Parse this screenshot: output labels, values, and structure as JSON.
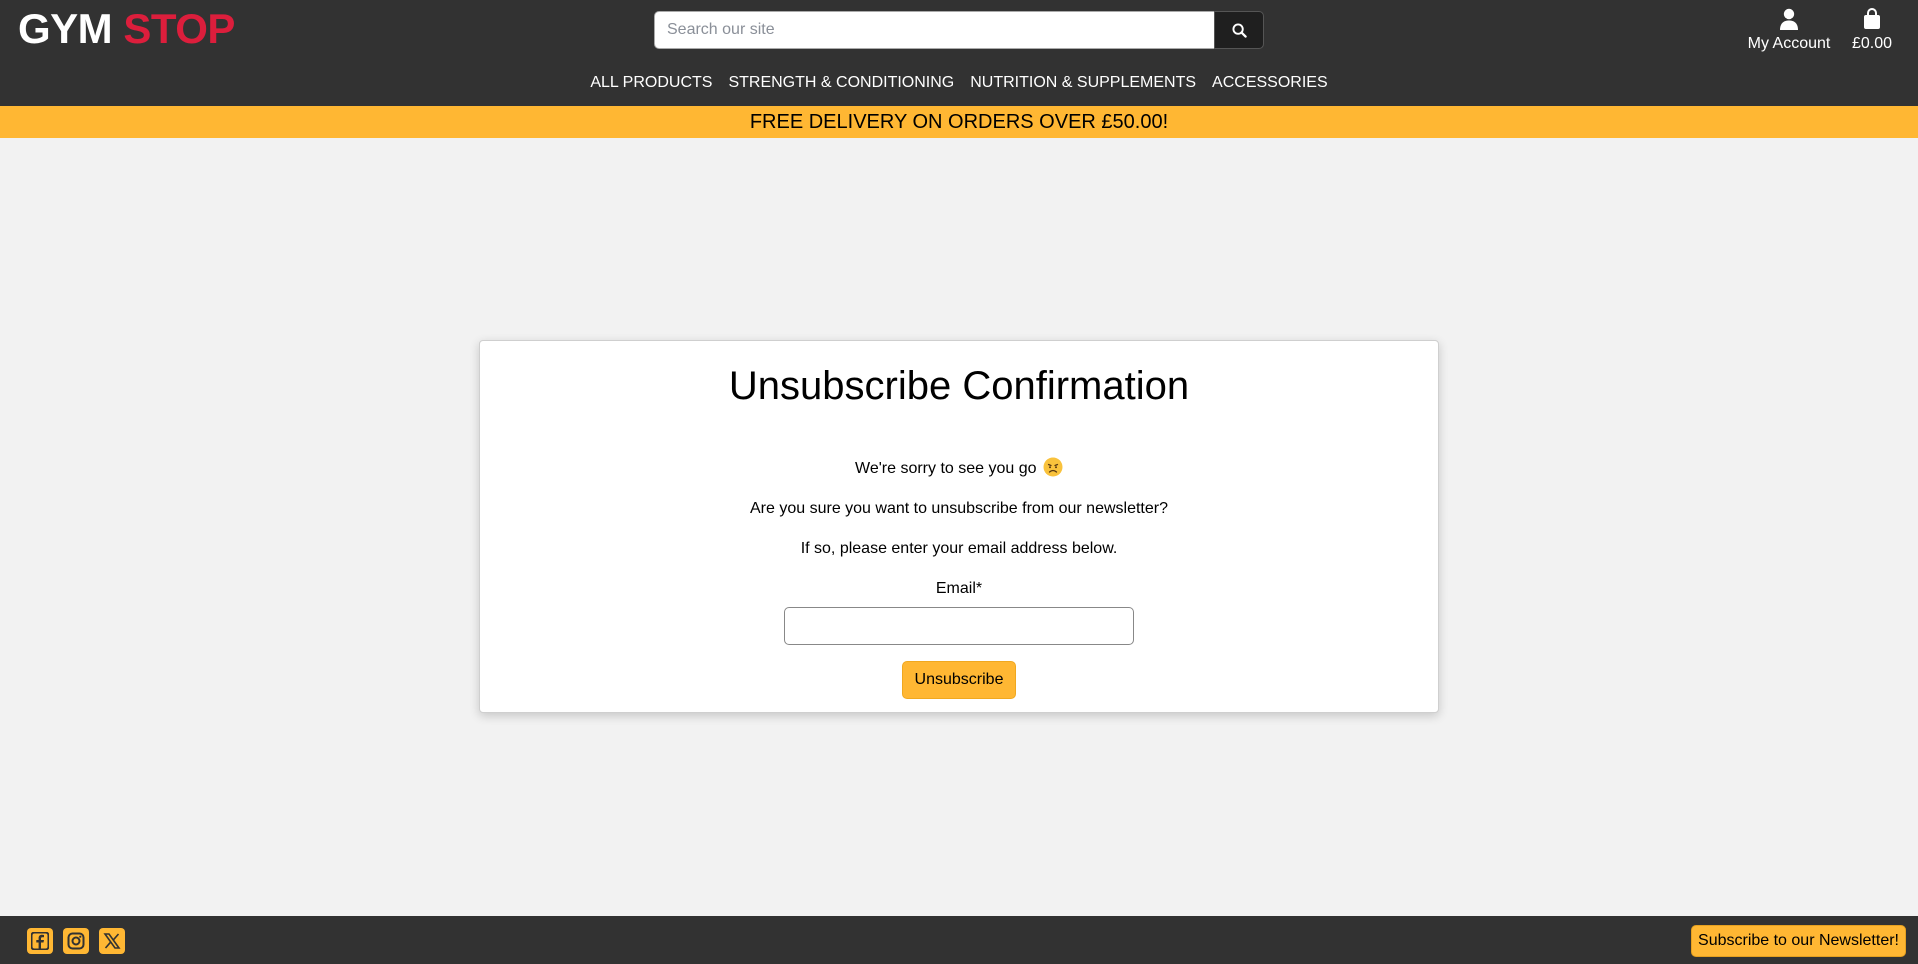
{
  "header": {
    "logo_part1": "GYM",
    "logo_part2": "STOP",
    "search_placeholder": "Search our site",
    "account_label": "My Account",
    "bag_total": "£0.00",
    "nav": [
      {
        "label": "ALL PRODUCTS"
      },
      {
        "label": "STRENGTH & CONDITIONING"
      },
      {
        "label": "NUTRITION & SUPPLEMENTS"
      },
      {
        "label": "ACCESSORIES"
      }
    ]
  },
  "banner": {
    "text": "FREE DELIVERY ON ORDERS OVER £50.00!"
  },
  "main": {
    "title": "Unsubscribe Confirmation",
    "sorry_text": "We're sorry to see you go",
    "sorry_emoji": "disappointed-face-emoji",
    "confirm_text": "Are you sure you want to unsubscribe from our newsletter?",
    "instruction_text": "If so, please enter your email address below.",
    "email_label": "Email*",
    "email_value": "",
    "submit_label": "Unsubscribe"
  },
  "footer": {
    "social_icons": [
      "facebook-icon",
      "instagram-icon",
      "x-twitter-icon"
    ],
    "newsletter_label": "Subscribe to our Newsletter!"
  },
  "colors": {
    "header_bg": "#323232",
    "brand_red": "#dc1e3c",
    "accent_yellow": "#ffb733",
    "page_bg": "#f2f2f2"
  }
}
